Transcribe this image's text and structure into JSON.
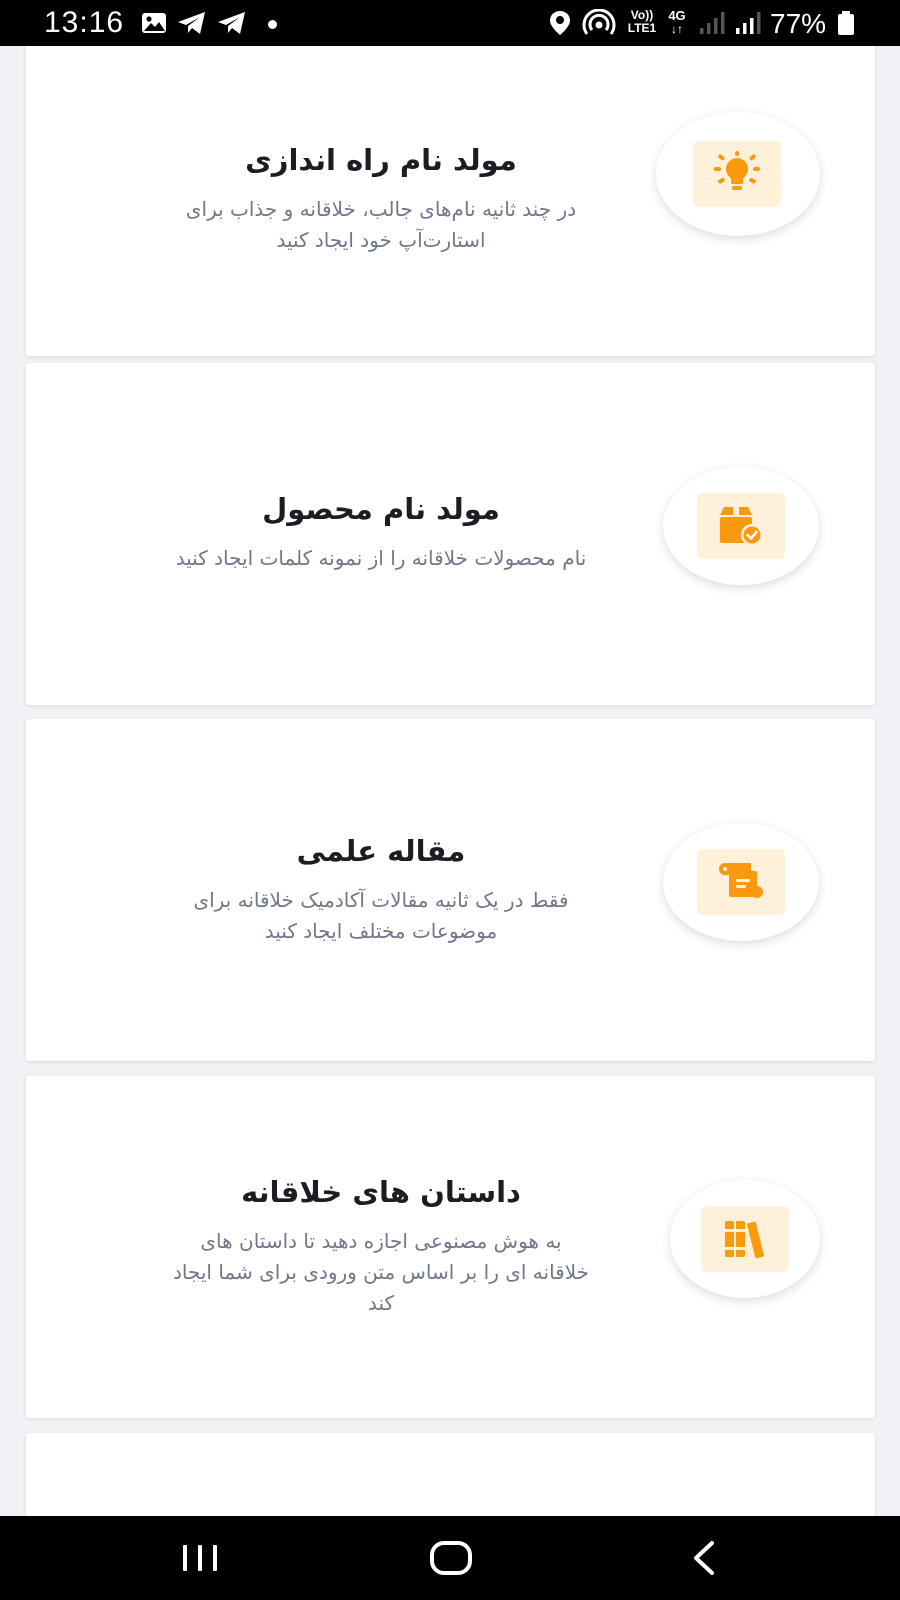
{
  "status_bar": {
    "time": "13:16",
    "volte_top": "Vo))",
    "volte_bottom": "LTE1",
    "network_type": "4G",
    "battery_percent": "77%",
    "icons": [
      "image-icon",
      "telegram-icon",
      "telegram-icon",
      "location-icon",
      "hotspot-icon",
      "signal-icon",
      "battery-icon"
    ]
  },
  "accent_color": "#f99a0e",
  "tile_color": "#fff1d9",
  "cards": [
    {
      "icon": "lightbulb-icon",
      "title": "مولد نام راه اندازی",
      "desc_lines": [
        "در چند ثانیه نام‌های جالب، خلاقانه و جذاب برای",
        "استارت‌آپ خود ایجاد کنید"
      ]
    },
    {
      "icon": "box-check-icon",
      "title": "مولد نام محصول",
      "desc_lines": [
        "نام محصولات خلاقانه را از نمونه کلمات ایجاد کنید"
      ]
    },
    {
      "icon": "scroll-icon",
      "title": "مقاله علمی",
      "desc_lines": [
        "فقط در یک ثانیه مقالات آکادمیک خلاقانه برای",
        "موضوعات مختلف ایجاد کنید"
      ]
    },
    {
      "icon": "books-icon",
      "title": "داستان های خلاقانه",
      "desc_lines": [
        "به هوش مصنوعی اجازه دهید تا داستان های",
        "خلاقانه ای را بر اساس متن ورودی برای شما ایجاد",
        "کند"
      ]
    }
  ],
  "nav_bar": {
    "buttons": [
      "recent-apps-icon",
      "home-icon",
      "back-icon"
    ]
  }
}
